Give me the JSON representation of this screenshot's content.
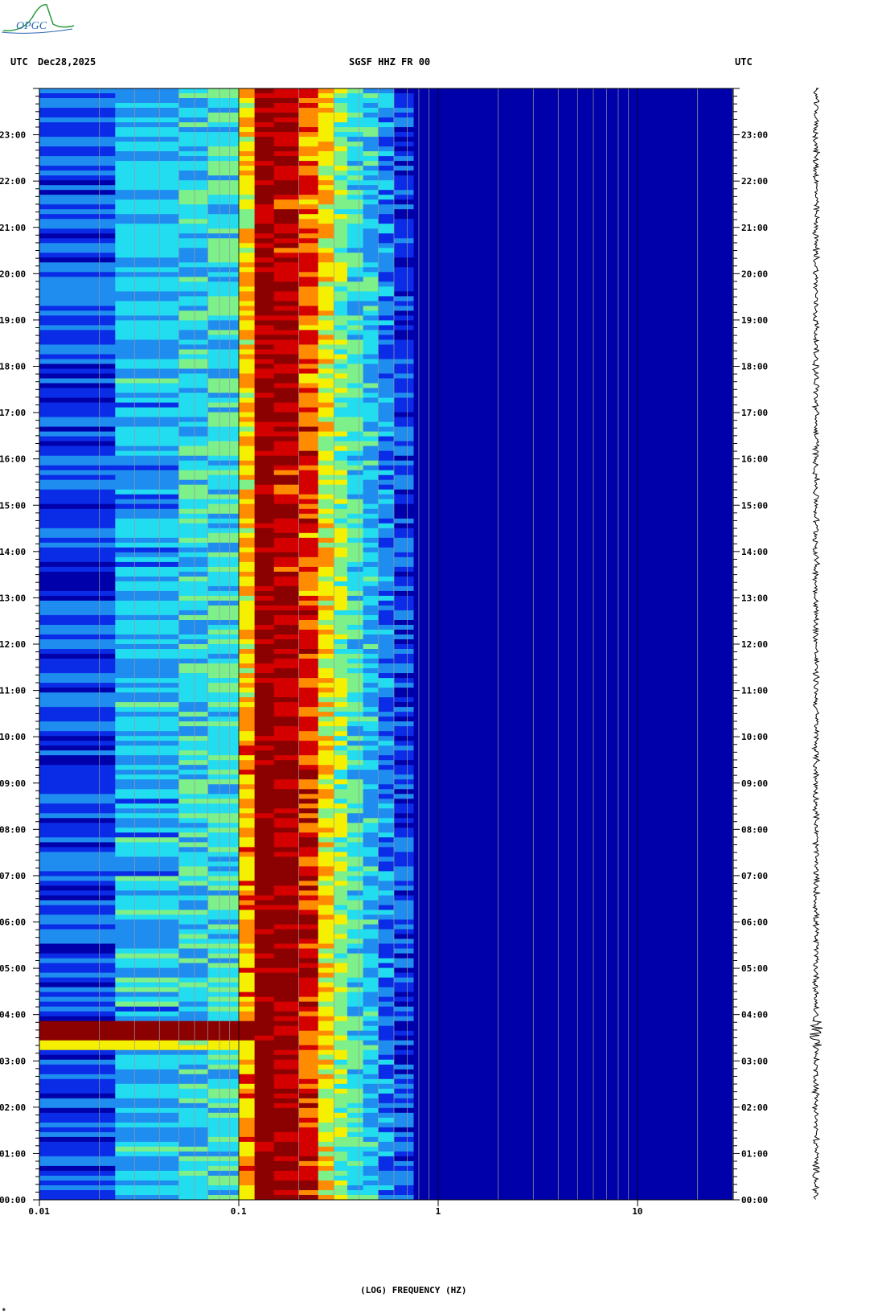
{
  "header": {
    "left_tz": "UTC",
    "date": "Dec28,2025",
    "station": "SGSF HHZ FR 00",
    "right_tz": "UTC"
  },
  "logo": {
    "text": "OPGC"
  },
  "colors": {
    "low": "#0000aa",
    "blue": "#0a2ce6",
    "cyan": "#22ddf0",
    "yellow": "#f5f000",
    "orange": "#ff8c00",
    "red": "#d40000",
    "darkred": "#8b0000"
  },
  "chart_data": {
    "type": "heatmap",
    "xlabel": "(LOG) FREQUENCY (HZ)",
    "xscale": "log",
    "xlim": [
      0.01,
      30
    ],
    "xticks": [
      {
        "value": 0.01,
        "label": "0.01"
      },
      {
        "value": 0.1,
        "label": "0.1"
      },
      {
        "value": 1,
        "label": "1"
      },
      {
        "value": 10,
        "label": "10"
      }
    ],
    "ylim_hours": [
      0,
      24
    ],
    "yticks": [
      "00:00",
      "01:00",
      "02:00",
      "03:00",
      "04:00",
      "05:00",
      "06:00",
      "07:00",
      "08:00",
      "09:00",
      "10:00",
      "11:00",
      "12:00",
      "13:00",
      "14:00",
      "15:00",
      "16:00",
      "17:00",
      "18:00",
      "19:00",
      "20:00",
      "21:00",
      "22:00",
      "23:00"
    ],
    "peak_band_hz": [
      0.12,
      0.2
    ],
    "event_hours": [
      3.3,
      3.8
    ],
    "grid": true
  }
}
